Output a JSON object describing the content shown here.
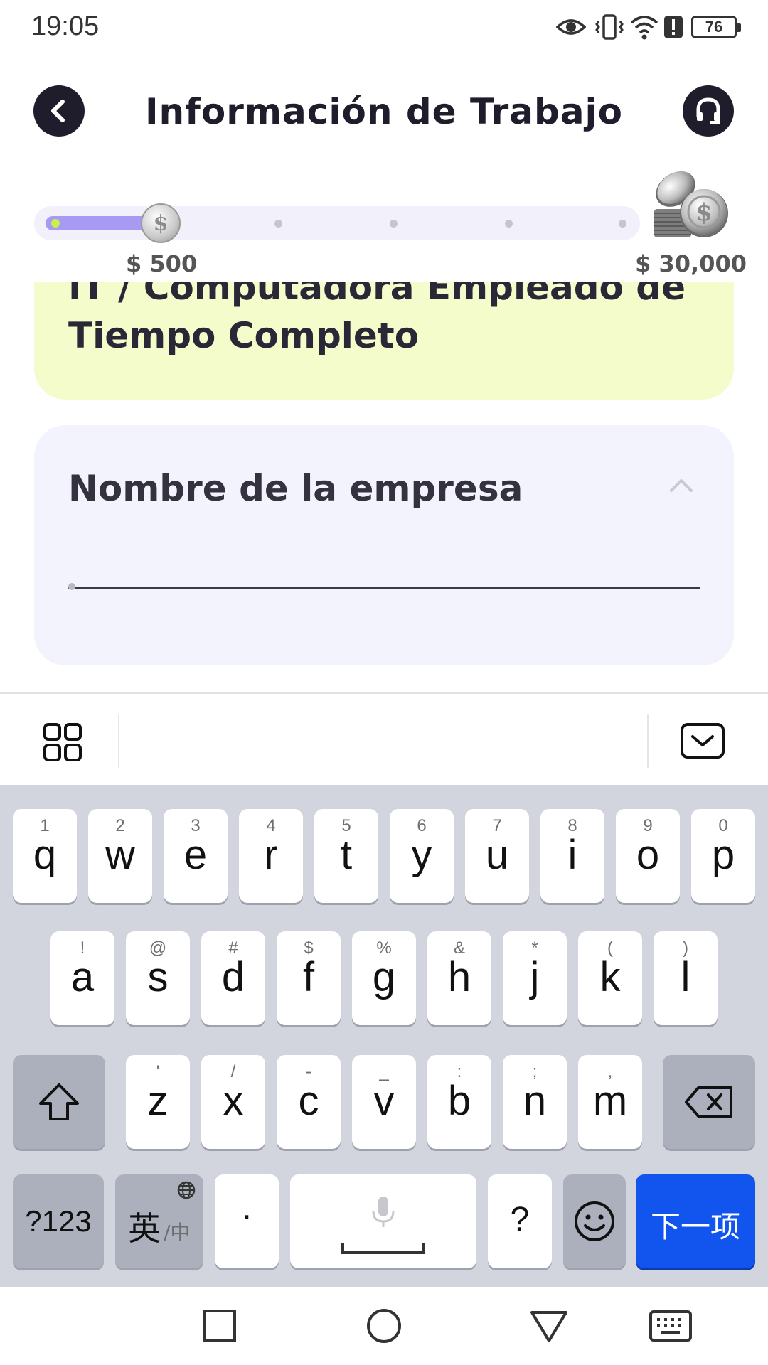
{
  "status_bar": {
    "time": "19:05",
    "icons": [
      "eye-icon",
      "vibrate-icon",
      "wifi-icon",
      "alert-icon",
      "battery-icon"
    ],
    "battery_level": "76"
  },
  "header": {
    "title": "Información de Trabajo",
    "back_icon": "chevron-left-icon",
    "support_icon": "headset-icon"
  },
  "progress": {
    "min_label": "$ 500",
    "max_label": "$ 30,000",
    "fraction": 0.19,
    "accent": "#a79af3"
  },
  "job_card": {
    "title": "IT / Computadora Empleado de Tiempo Completo",
    "background": "#f4fccb"
  },
  "company": {
    "label": "Nombre de la empresa",
    "value": "",
    "placeholder": ""
  },
  "keyboard": {
    "row1": [
      {
        "hint": "1",
        "key": "q"
      },
      {
        "hint": "2",
        "key": "w"
      },
      {
        "hint": "3",
        "key": "e"
      },
      {
        "hint": "4",
        "key": "r"
      },
      {
        "hint": "5",
        "key": "t"
      },
      {
        "hint": "6",
        "key": "y"
      },
      {
        "hint": "7",
        "key": "u"
      },
      {
        "hint": "8",
        "key": "i"
      },
      {
        "hint": "9",
        "key": "o"
      },
      {
        "hint": "0",
        "key": "p"
      }
    ],
    "row2": [
      {
        "hint": "!",
        "key": "a"
      },
      {
        "hint": "@",
        "key": "s"
      },
      {
        "hint": "#",
        "key": "d"
      },
      {
        "hint": "$",
        "key": "f"
      },
      {
        "hint": "%",
        "key": "g"
      },
      {
        "hint": "&",
        "key": "h"
      },
      {
        "hint": "*",
        "key": "j"
      },
      {
        "hint": "(",
        "key": "k"
      },
      {
        "hint": ")",
        "key": "l"
      }
    ],
    "row3": [
      {
        "hint": "'",
        "key": "z"
      },
      {
        "hint": "/",
        "key": "x"
      },
      {
        "hint": "-",
        "key": "c"
      },
      {
        "hint": "_",
        "key": "v"
      },
      {
        "hint": ":",
        "key": "b"
      },
      {
        "hint": ";",
        "key": "n"
      },
      {
        "hint": ",",
        "key": "m"
      }
    ],
    "symbols_label": "?123",
    "lang_main": "英",
    "lang_sub": "/中",
    "period_label": "·",
    "question_label": "?",
    "next_label": "下一项",
    "accent": "#1155ee"
  },
  "nav_bar": {
    "icons": [
      "square-icon",
      "circle-icon",
      "triangle-icon",
      "keyboard-icon"
    ]
  }
}
